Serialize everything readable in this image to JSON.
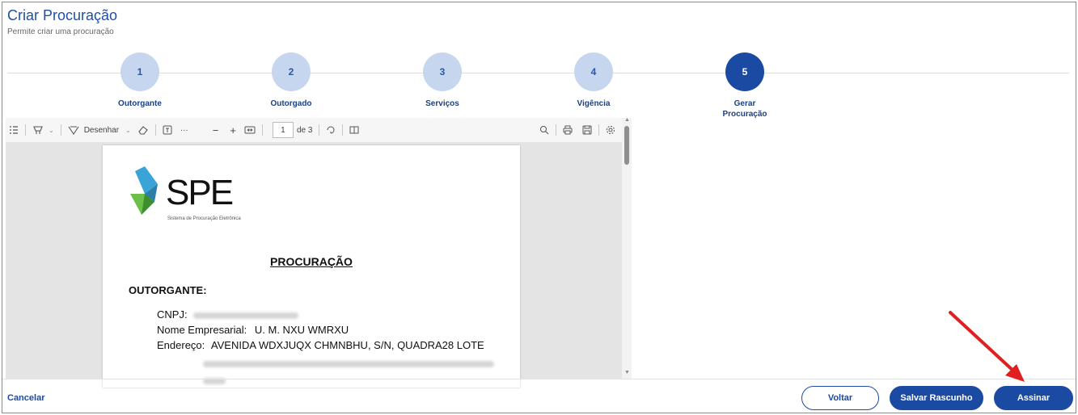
{
  "header": {
    "title": "Criar Procuração",
    "subtitle": "Permite criar uma procuração"
  },
  "stepper": {
    "steps": [
      {
        "number": "1",
        "label": "Outorgante"
      },
      {
        "number": "2",
        "label": "Outorgado"
      },
      {
        "number": "3",
        "label": "Serviços"
      },
      {
        "number": "4",
        "label": "Vigência"
      },
      {
        "number": "5",
        "label": "Gerar Procuração"
      }
    ],
    "active_index": 4
  },
  "viewer_toolbar": {
    "draw_label": "Desenhar",
    "more": "···",
    "zoom_out": "−",
    "zoom_in": "+",
    "current_page": "1",
    "page_total": "de 3"
  },
  "document": {
    "logo_text": "SPE",
    "logo_subtitle": "Sistema de Procuração Eletrônica",
    "heading": "PROCURAÇÃO",
    "section": "OUTORGANTE:",
    "cnpj_label": "CNPJ:",
    "name_label": "Nome Empresarial:",
    "name_value": "U. M. NXU WMRXU",
    "address_label": "Endereço:",
    "address_value": "AVENIDA WDXJUQX CHMNBHU, S/N, QUADRA28 LOTE"
  },
  "footer": {
    "cancel": "Cancelar",
    "back": "Voltar",
    "save_draft": "Salvar Rascunho",
    "sign": "Assinar"
  },
  "colors": {
    "primary": "#1b4aa3",
    "step_inactive": "#c6d6ee",
    "annotation_arrow": "#e02020"
  }
}
